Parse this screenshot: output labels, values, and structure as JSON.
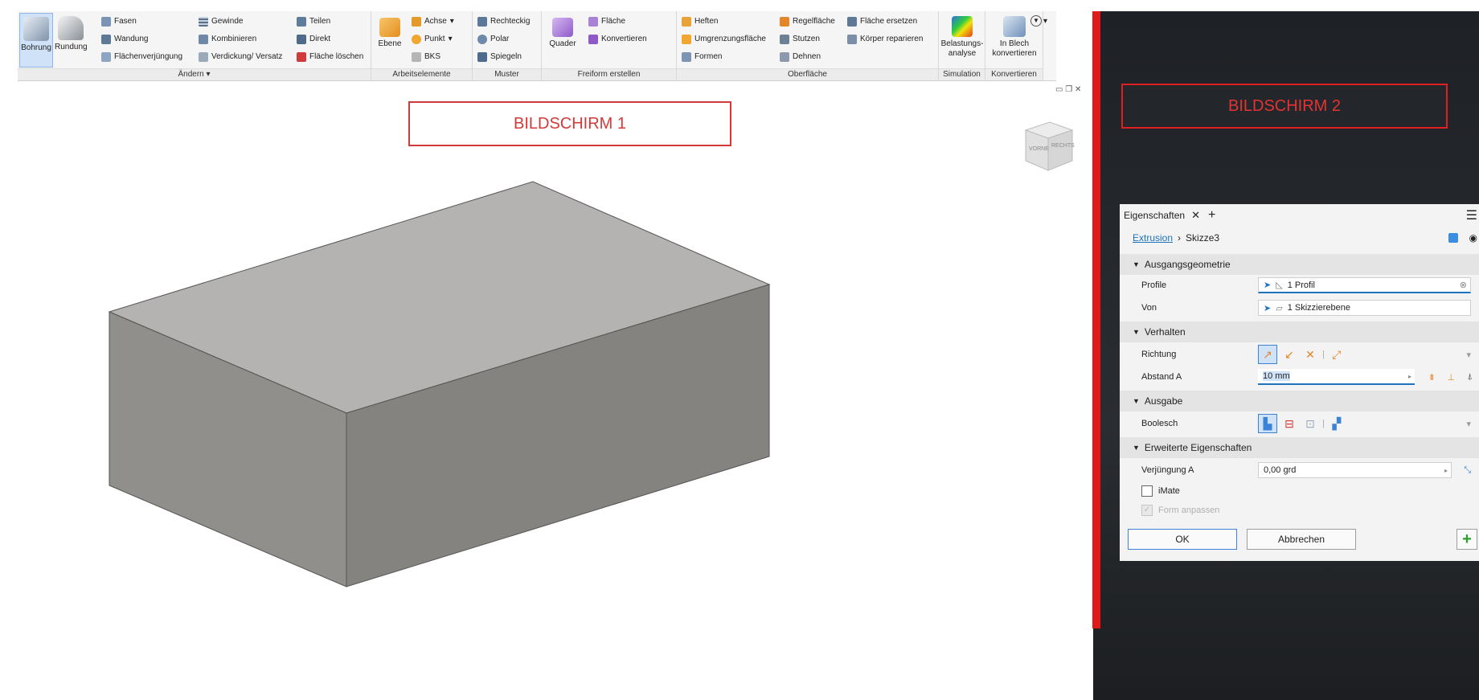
{
  "ribbon": {
    "groups": [
      {
        "label": "Ändern ▾"
      },
      {
        "label": "Arbeitselemente"
      },
      {
        "label": "Muster"
      },
      {
        "label": "Freiform erstellen"
      },
      {
        "label": "Oberfläche"
      },
      {
        "label": "Simulation"
      },
      {
        "label": "Konvertieren"
      }
    ],
    "aendern": {
      "bohrung": "Bohrung",
      "rundung": "Rundung",
      "fasen": "Fasen",
      "wandung": "Wandung",
      "flaechenverjuengung": "Flächenverjüngung",
      "gewinde": "Gewinde",
      "kombinieren": "Kombinieren",
      "verdickung": "Verdickung/ Versatz",
      "teilen": "Teilen",
      "direkt": "Direkt",
      "flaeche_loeschen": "Fläche löschen"
    },
    "arbeitselemente": {
      "ebene": "Ebene",
      "achse": "Achse",
      "punkt": "Punkt",
      "bks": "BKS"
    },
    "muster": {
      "rechteckig": "Rechteckig",
      "polar": "Polar",
      "spiegeln": "Spiegeln"
    },
    "freiform": {
      "quader": "Quader",
      "flaeche": "Fläche",
      "konvertieren": "Konvertieren"
    },
    "oberflaeche": {
      "heften": "Heften",
      "umgrenzungsflaeche": "Umgrenzungsfläche",
      "formen": "Formen",
      "regelflaeche": "Regelfläche",
      "stutzen": "Stutzen",
      "dehnen": "Dehnen",
      "flaeche_ersetzen": "Fläche ersetzen",
      "koerper_reparieren": "Körper reparieren"
    },
    "simulation": {
      "belastung_line1": "Belastungs-",
      "belastung_line2": "analyse"
    },
    "konvertieren": {
      "line1": "In Blech",
      "line2": "konvertieren"
    }
  },
  "viewport": {
    "screen1_label": "BILDSCHIRM 1",
    "viewcube_front": "VORNE",
    "viewcube_right": "RECHTS"
  },
  "screen2_label": "BILDSCHIRM 2",
  "panel": {
    "tab_label": "Eigenschaften",
    "breadcrumb_link": "Extrusion",
    "breadcrumb_current": "Skizze3",
    "sections": {
      "ausgangsgeometrie": "Ausgangsgeometrie",
      "verhalten": "Verhalten",
      "ausgabe": "Ausgabe",
      "erweitert": "Erweiterte Eigenschaften"
    },
    "profile_label": "Profile",
    "profile_value": "1 Profil",
    "von_label": "Von",
    "von_value": "1 Skizzierebene",
    "richtung_label": "Richtung",
    "abstand_label": "Abstand A",
    "abstand_value": "10 mm",
    "boolesch_label": "Boolesch",
    "verjuengung_label": "Verjüngung A",
    "verjuengung_value": "0,00 grd",
    "imate_label": "iMate",
    "form_anpassen_label": "Form anpassen",
    "ok_label": "OK",
    "abbrechen_label": "Abbrechen"
  },
  "colors": {
    "accent_blue": "#1e73be",
    "red_frame": "#e01919",
    "box_top": "#b4b3b1",
    "box_left": "#908f8c",
    "box_front": "#84837f"
  }
}
